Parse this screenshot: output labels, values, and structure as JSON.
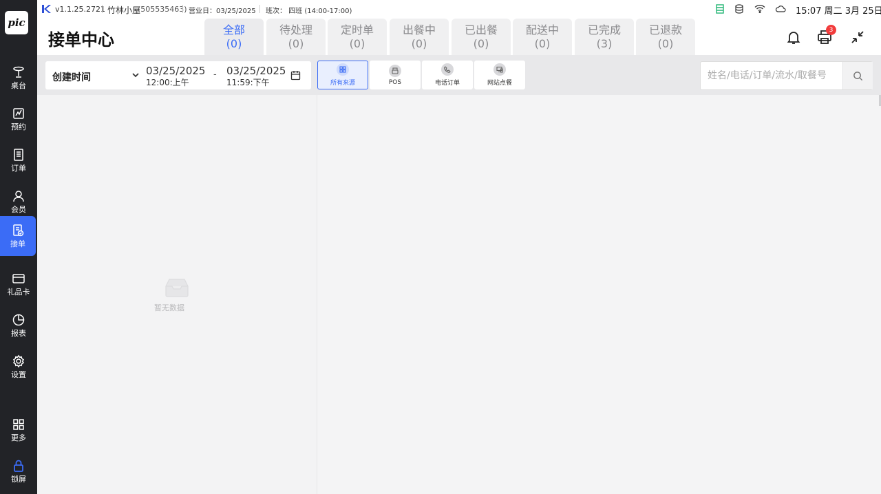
{
  "app": {
    "logo_text": "pic",
    "accent": "#3b6cf6",
    "sidebar_bg": "#222327"
  },
  "statusbar": {
    "version": "v1.1.25.2721",
    "store": "竹林小屋",
    "store_id": "(505535463)",
    "business_day": "营业日：03/25/2025",
    "shift": "班次：  四班 (14:00-17:00)",
    "clock": "15:07 周二 3月 25日"
  },
  "sidebar": {
    "items": [
      {
        "label": "桌台",
        "icon": "table-icon"
      },
      {
        "label": "预约",
        "icon": "reservation-icon"
      },
      {
        "label": "订单",
        "icon": "order-icon"
      },
      {
        "label": "会员",
        "icon": "member-icon"
      },
      {
        "label": "接单",
        "icon": "accept-order-icon",
        "active": true
      },
      {
        "label": "礼品卡",
        "icon": "gift-card-icon"
      },
      {
        "label": "报表",
        "icon": "report-icon"
      },
      {
        "label": "设置",
        "icon": "settings-icon"
      },
      {
        "label": "更多",
        "icon": "more-icon"
      },
      {
        "label": "锁屏",
        "icon": "lock-icon"
      }
    ]
  },
  "header": {
    "title": "接单中心",
    "tabs": [
      {
        "label": "全部",
        "count": "(0)",
        "active": true
      },
      {
        "label": "待处理",
        "count": "(0)"
      },
      {
        "label": "定时单",
        "count": "(0)"
      },
      {
        "label": "出餐中",
        "count": "(0)"
      },
      {
        "label": "已出餐",
        "count": "(0)"
      },
      {
        "label": "配送中",
        "count": "(0)"
      },
      {
        "label": "已完成",
        "count": "(3)"
      },
      {
        "label": "已退款",
        "count": "(0)"
      }
    ],
    "printer_badge": "3"
  },
  "filter": {
    "date_type": "创建时间",
    "start_date": "03/25/2025",
    "start_time": "12:00:上午",
    "end_date": "03/25/2025",
    "end_time": "11:59:下午",
    "dash": "-",
    "sources": [
      {
        "label": "所有来源",
        "icon": "grid-icon",
        "active": true
      },
      {
        "label": "POS",
        "icon": "pos-icon"
      },
      {
        "label": "电话订单",
        "icon": "phone-icon"
      },
      {
        "label": "网站点餐",
        "icon": "web-order-icon"
      }
    ],
    "search_placeholder": "姓名/电话/订单/流水/取餐号"
  },
  "list": {
    "empty_text": "暂无数据"
  }
}
